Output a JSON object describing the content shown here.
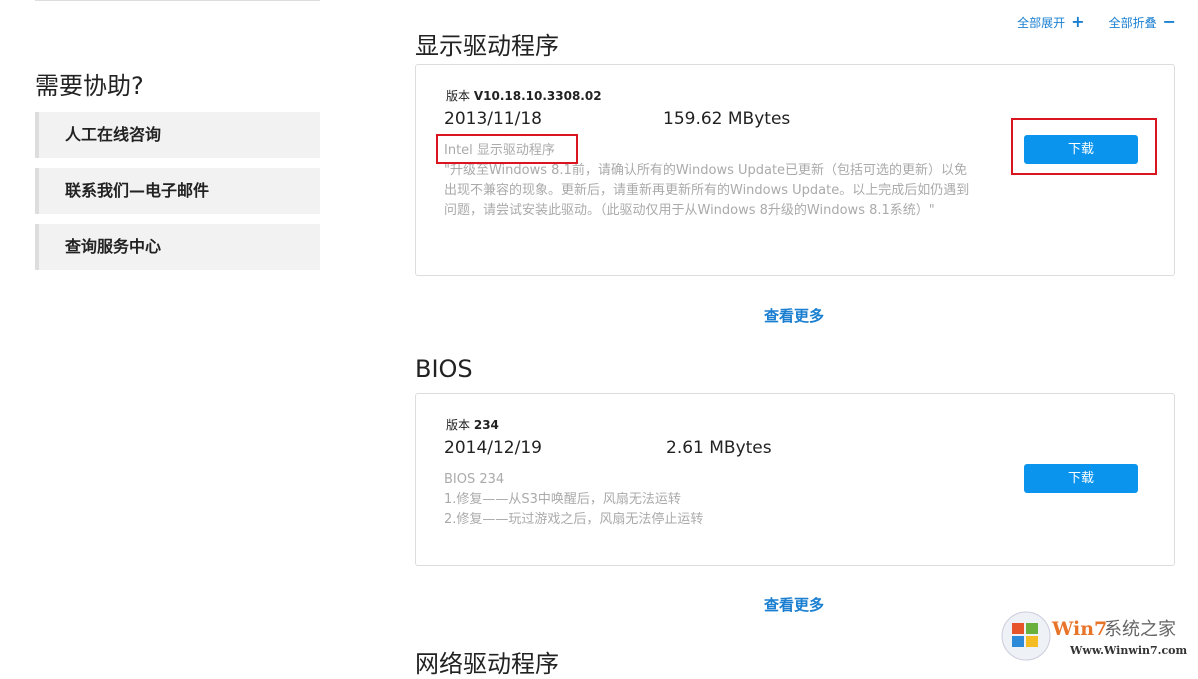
{
  "toolbar": {
    "expand_all": "全部展开",
    "expand_icon": "+",
    "collapse_all": "全部折叠",
    "collapse_icon": "−"
  },
  "sidebar": {
    "title": "需要协助?",
    "items": [
      {
        "label": "人工在线咨询"
      },
      {
        "label": "联系我们—电子邮件"
      },
      {
        "label": "查询服务中心"
      }
    ]
  },
  "sections": [
    {
      "title": "显示驱动程序",
      "version_label": "版本",
      "version": "V10.18.10.3308.02",
      "date": "2013/11/18",
      "size": "159.62 MBytes",
      "name": "Intel 显示驱动程序",
      "desc": "\"升级至Windows 8.1前，请确认所有的Windows Update已更新（包括可选的更新）以免出现不兼容的现象。更新后，请重新再更新所有的Windows Update。以上完成后如仍遇到问题，请尝试安装此驱动。（此驱动仅用于从Windows 8升级的Windows 8.1系统）\"",
      "download": "下载",
      "more": "查看更多"
    },
    {
      "title": "BIOS",
      "version_label": "版本",
      "version": "234",
      "date": "2014/12/19",
      "size": "2.61 MBytes",
      "name": "BIOS 234",
      "desc_lines": [
        "1.修复——从S3中唤醒后，风扇无法运转",
        "2.修复——玩过游戏之后，风扇无法停止运转"
      ],
      "download": "下载",
      "more": "查看更多"
    },
    {
      "title": "网络驱动程序"
    }
  ],
  "watermark": {
    "brand": "Win7系统之家",
    "url": "Www.Winwin7.com"
  },
  "colors": {
    "accent": "#0a94ee",
    "link": "#1a7fd0",
    "highlight": "#d9151f"
  }
}
